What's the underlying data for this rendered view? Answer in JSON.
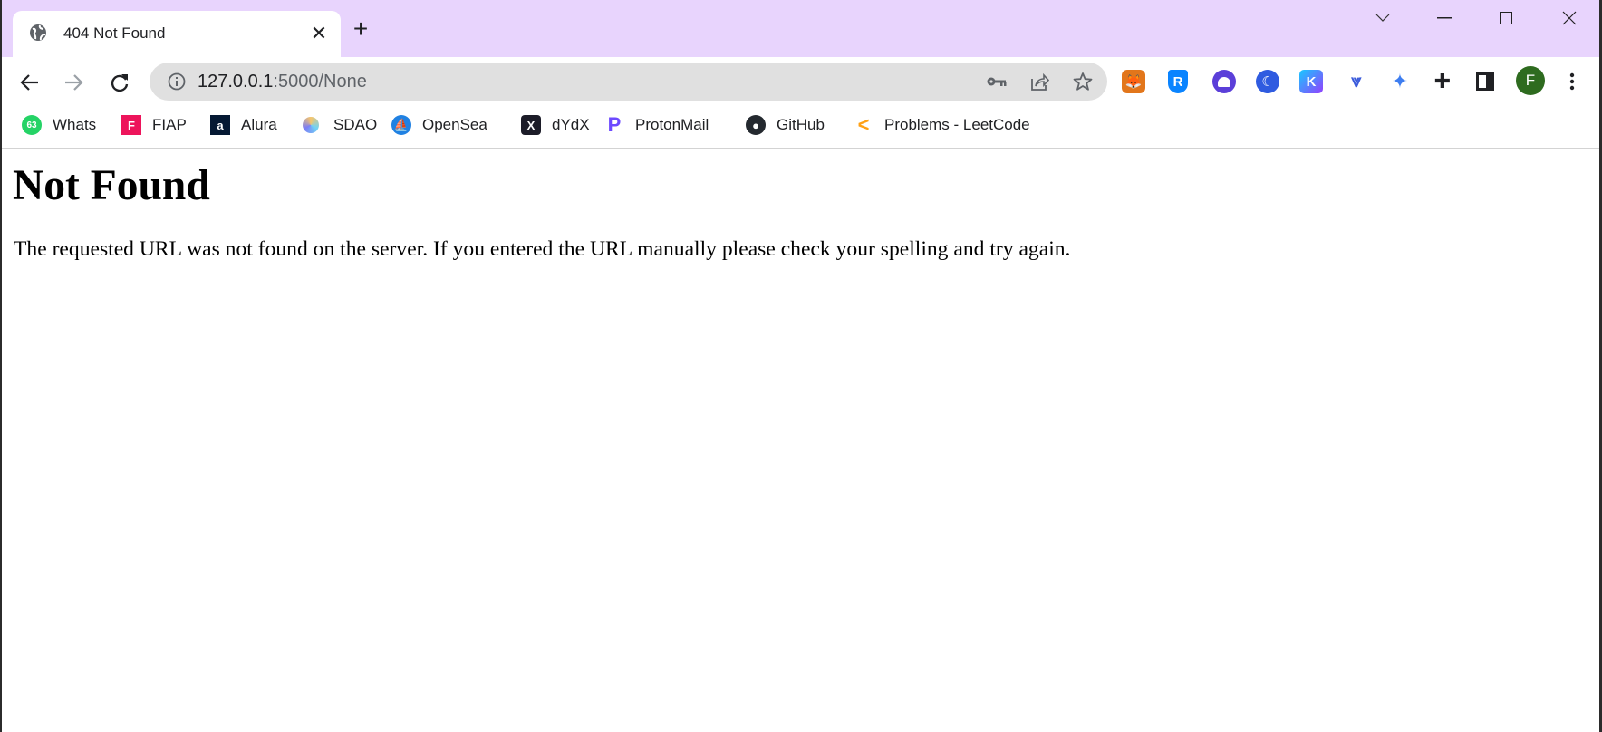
{
  "tab": {
    "title": "404 Not Found",
    "favicon": "globe-icon"
  },
  "address_bar": {
    "host": "127.0.0.1",
    "rest": ":5000/None"
  },
  "bookmarks": [
    {
      "label": "Whats",
      "icon": "whatsapp-icon",
      "badge": "63",
      "color": "#25d366"
    },
    {
      "label": "FIAP",
      "icon": "fiap-icon",
      "color": "#ed145b"
    },
    {
      "label": "Alura",
      "icon": "alura-icon",
      "color": "#051933"
    },
    {
      "label": "SDAO",
      "icon": "sdao-icon",
      "color": "#8fb8f0"
    },
    {
      "label": "OpenSea",
      "icon": "opensea-icon",
      "color": "#2081e2"
    },
    {
      "label": "dYdX",
      "icon": "dydx-icon",
      "color": "#1c1c28"
    },
    {
      "label": "ProtonMail",
      "icon": "protonmail-icon",
      "color": "#6d4aff"
    },
    {
      "label": "GitHub",
      "icon": "github-icon",
      "color": "#24292f"
    },
    {
      "label": "Problems - LeetCode",
      "icon": "leetcode-icon",
      "color": "#ffa116"
    }
  ],
  "profile": {
    "initial": "F",
    "color": "#2e6b1f"
  },
  "page": {
    "heading": "Not Found",
    "message": "The requested URL was not found on the server. If you entered the URL manually please check your spelling and try again."
  }
}
